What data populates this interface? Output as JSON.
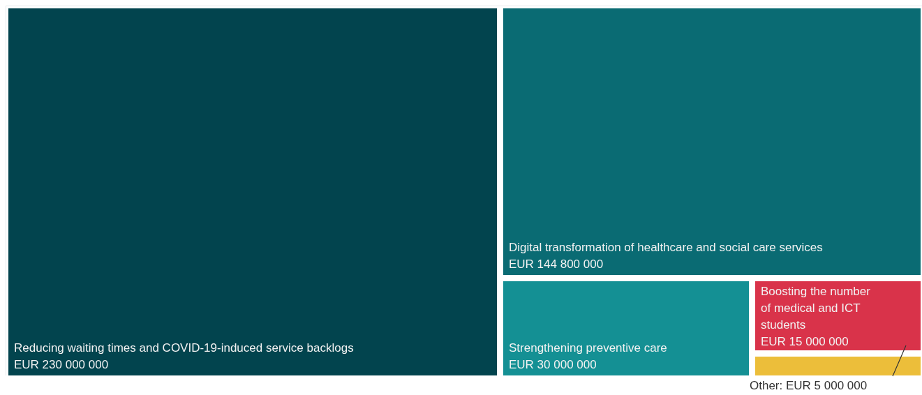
{
  "tiles": [
    {
      "label": "Reducing waiting times and COVID-19-induced service backlogs",
      "amount": "EUR 230 000 000",
      "color": "#02444e"
    },
    {
      "label": "Digital transformation of healthcare and social care services",
      "amount": "EUR 144 800 000",
      "color": "#0a6b73"
    },
    {
      "label": "Strengthening preventive care",
      "amount": "EUR 30 000 000",
      "color": "#149094"
    },
    {
      "label": "Boosting the number of medical and ICT students",
      "amount": "EUR 15 000 000",
      "color": "#d9334a"
    }
  ],
  "other": {
    "callout": "Other: EUR 5 000 000",
    "color": "#ecbe3a"
  }
}
